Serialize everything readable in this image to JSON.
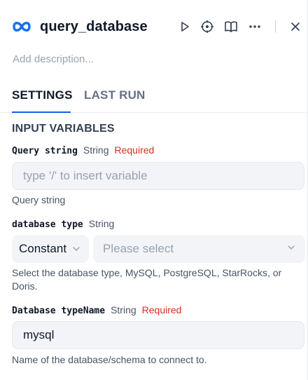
{
  "header": {
    "title": "query_database",
    "description_placeholder": "Add description...",
    "icons": [
      "infinity-logo-icon",
      "play-icon",
      "crosshair-icon",
      "book-icon",
      "more-icon",
      "close-icon"
    ]
  },
  "tabs": [
    {
      "label": "SETTINGS",
      "active": true
    },
    {
      "label": "LAST RUN",
      "active": false
    }
  ],
  "section": {
    "title": "INPUT VARIABLES"
  },
  "fields": [
    {
      "name": "Query string",
      "type": "String",
      "required_label": "Required",
      "placeholder": "type '/' to insert variable",
      "helper": "Query string"
    },
    {
      "name": "database type",
      "type": "String",
      "mode_value": "Constant",
      "select_placeholder": "Please select",
      "helper": "Select the database type, MySQL, PostgreSQL, StarRocks, or Doris."
    },
    {
      "name": "Database typeName",
      "type": "String",
      "required_label": "Required",
      "value": "mysql",
      "helper": "Name of the database/schema to connect to."
    }
  ],
  "colors": {
    "accent": "#155eef",
    "required": "#d92d20",
    "input_bg": "#f2f4f7"
  }
}
